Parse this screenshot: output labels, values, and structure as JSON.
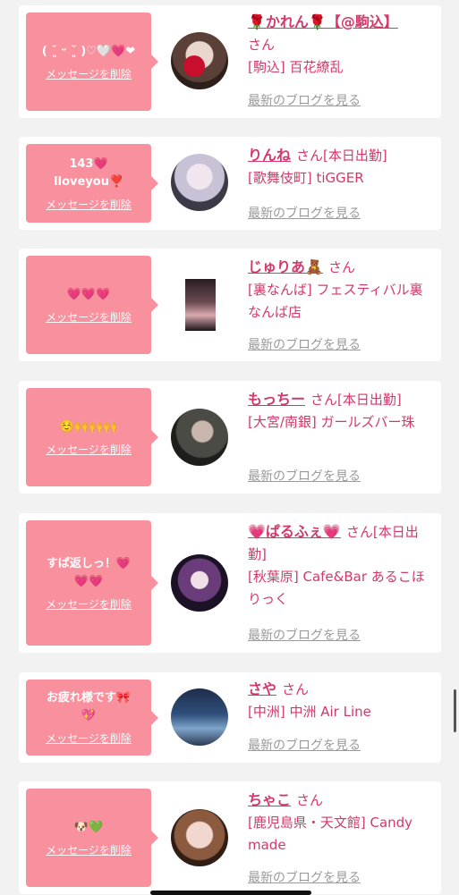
{
  "cards": [
    {
      "message": "( ˘͈ ᵕ ˘͈ )♡🤍💗❤",
      "delete": "メッセージを削除",
      "name": "🌹かれん🌹【@駒込】",
      "san": "さん",
      "shop": "[駒込] 百花繚乱",
      "blog": "最新のブログを見る"
    },
    {
      "message": "143💗\nIloveyou❣️",
      "delete": "メッセージを削除",
      "name": "りんね",
      "san": "さん[本日出勤]",
      "shop": "[歌舞伎町] tiGGER",
      "blog": "最新のブログを見る"
    },
    {
      "message": "💗💗💗",
      "delete": "メッセージを削除",
      "name": "じゅりあ🧸",
      "san": "さん",
      "shop": "[裏なんば] フェスティバル裏なんば店",
      "blog": "最新のブログを見る"
    },
    {
      "message": "☺️🙌🙌🙌",
      "delete": "メッセージを削除",
      "name": "もっちー",
      "san": "さん[本日出勤]",
      "shop": "[大宮/南銀] ガールズバー珠",
      "blog": "最新のブログを見る"
    },
    {
      "message": "すぱ返しっ！💗\n💗💗",
      "delete": "メッセージを削除",
      "name": "💗ぱるふぇ💗",
      "san": "さん[本日出勤]",
      "shop": "[秋葉原] Cafe&Bar あるこほりっく",
      "blog": "最新のブログを見る"
    },
    {
      "message": "お疲れ様です🎀\n💖",
      "delete": "メッセージを削除",
      "name": "さや",
      "san": "さん",
      "shop": "[中洲] 中洲 Air Line",
      "blog": "最新のブログを見る"
    },
    {
      "message": "🐶💚",
      "delete": "メッセージを削除",
      "name": "ちゃこ",
      "san": "さん",
      "shop": "[鹿児島県・天文館] Candy made",
      "blog": "最新のブログを見る"
    }
  ]
}
